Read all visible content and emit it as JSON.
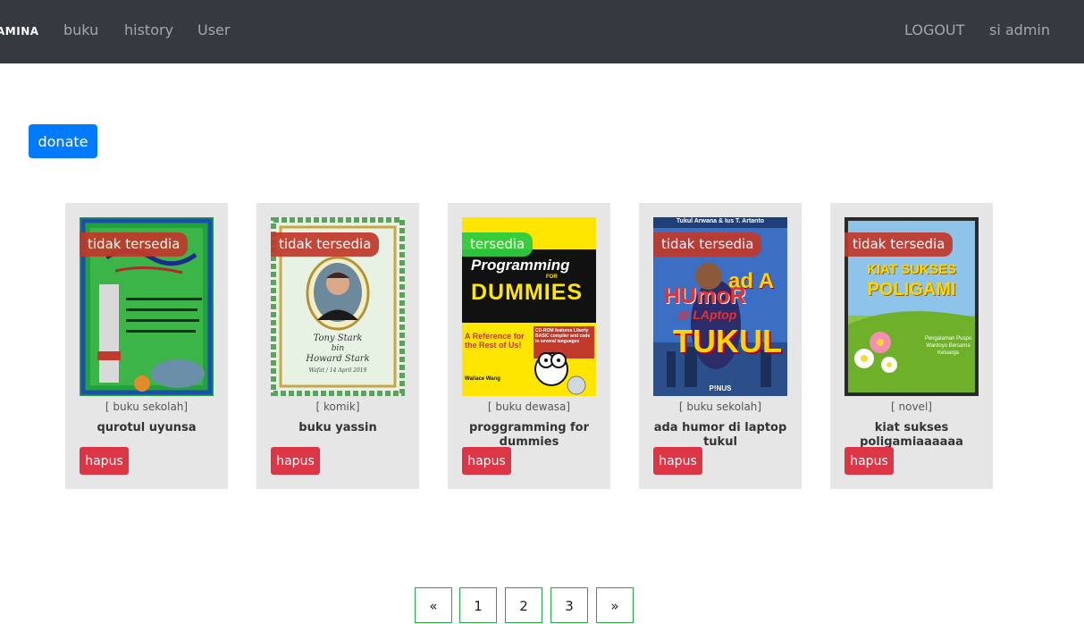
{
  "nav": {
    "brand": "AMINA",
    "links": [
      "buku",
      "history",
      "User"
    ],
    "logout": "LOGOUT",
    "user": "si admin"
  },
  "actions": {
    "donate": "donate"
  },
  "books": [
    {
      "status": "tidak tersedia",
      "category": "[ buku sekolah]",
      "title": "qurotul uyunsa",
      "delete": "hapus"
    },
    {
      "status": "tidak tersedia",
      "category": "[ komik]",
      "title": "buku yassin",
      "delete": "hapus"
    },
    {
      "status": "tersedia",
      "category": "[ buku dewasa]",
      "title": "proggramming for dummies",
      "delete": "hapus"
    },
    {
      "status": "tidak tersedia",
      "category": "[ buku sekolah]",
      "title": "ada humor di laptop tukul",
      "delete": "hapus"
    },
    {
      "status": "tidak tersedia",
      "category": "[ novel]",
      "title": "kiat sukses poligamiaaaaaa",
      "delete": "hapus"
    }
  ],
  "covers": {
    "book2": {
      "line1": "Tony Stark",
      "line2": "bin",
      "line3": "Howard Stark",
      "line4": "Wafat / 14 April 2019"
    },
    "book3": {
      "line1": "Programming",
      "line2": "FOR",
      "line3": "DUMMIES",
      "line4": "A Reference for the Rest of Us!",
      "line5": "CD-ROM features Liberty BASIC compiler and code in several languages",
      "author": "Wallace Wang"
    },
    "book4": {
      "authors": "Tukul Arwana & Ius T. Artanto",
      "line1": "ad A",
      "line2": "HUmoR",
      "line3": "di LAptop",
      "line4": "TUKUL",
      "publisher": "P!NUS"
    },
    "book5": {
      "line1": "KIAT SUKSES",
      "line2": "POLIGAMI",
      "line3": "Pengalaman Puspo Wardoyo Bersama Keluarga"
    }
  },
  "pagination": [
    "«",
    "1",
    "2",
    "3",
    "»"
  ],
  "colors": {
    "navbar": "#343a40",
    "primary": "#007bff",
    "danger": "#dc3545",
    "success": "#28a745",
    "card": "#e6e6e6"
  }
}
